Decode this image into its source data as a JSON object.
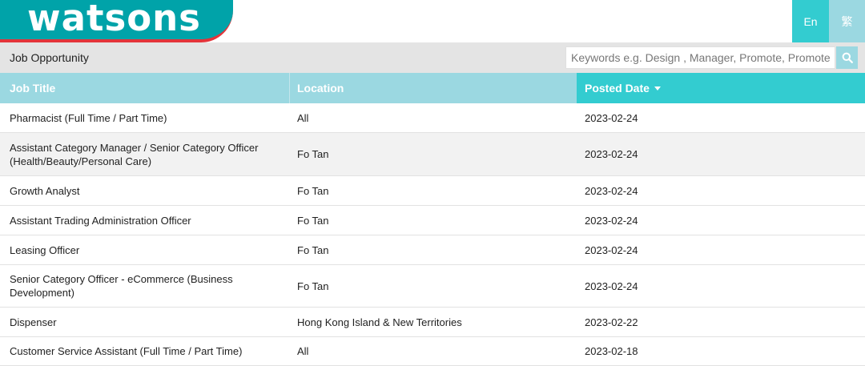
{
  "brand": {
    "logo_text": "watsons"
  },
  "language": {
    "en": "En",
    "tc": "繁"
  },
  "subbar": {
    "title": "Job Opportunity",
    "search_placeholder": "Keywords e.g. Design , Manager, Promote, Promoter"
  },
  "table": {
    "headers": {
      "title": "Job Title",
      "location": "Location",
      "posted": "Posted Date"
    },
    "rows": [
      {
        "title": "Pharmacist (Full Time / Part Time)",
        "location": "All",
        "date": "2023-02-24"
      },
      {
        "title": "Assistant Category Manager / Senior Category Officer (Health/Beauty/Personal Care)",
        "location": "Fo Tan",
        "date": "2023-02-24"
      },
      {
        "title": "Growth Analyst",
        "location": "Fo Tan",
        "date": "2023-02-24"
      },
      {
        "title": "Assistant Trading Administration Officer",
        "location": "Fo Tan",
        "date": "2023-02-24"
      },
      {
        "title": "Leasing Officer",
        "location": "Fo Tan",
        "date": "2023-02-24"
      },
      {
        "title": "Senior Category Officer - eCommerce (Business Development)",
        "location": "Fo Tan",
        "date": "2023-02-24"
      },
      {
        "title": "Dispenser",
        "location": "Hong Kong Island & New Territories",
        "date": "2023-02-22"
      },
      {
        "title": "Customer Service Assistant (Full Time / Part Time)",
        "location": "All",
        "date": "2023-02-18"
      }
    ]
  },
  "colors": {
    "brand_teal": "#00a3a9",
    "accent_red": "#e3343a",
    "header_light": "#9bd8e1",
    "header_active": "#33ccd0"
  },
  "icons": {
    "search": "search-icon",
    "sort": "caret-down-icon"
  }
}
